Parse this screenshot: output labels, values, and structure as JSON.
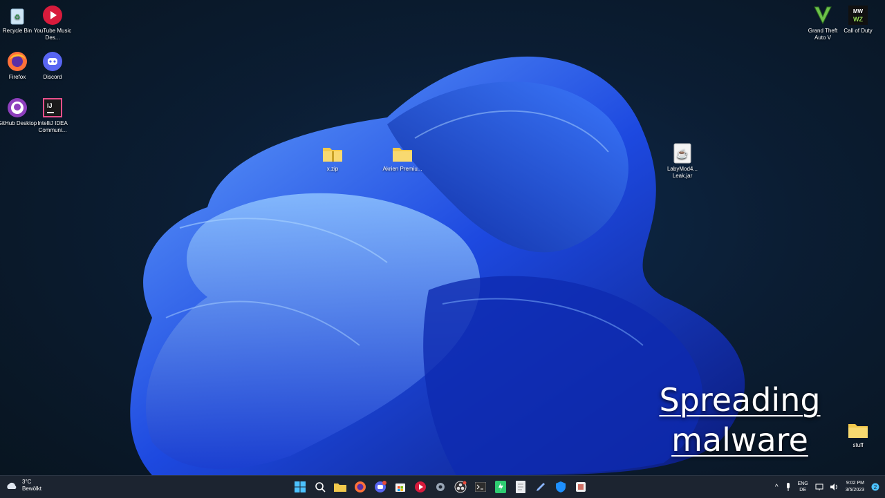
{
  "desktop": {
    "icons_left": [
      {
        "label": "Recycle Bin",
        "icon": "recycle-bin-icon"
      },
      {
        "label": "YouTube Music Des...",
        "icon": "youtube-music-icon"
      },
      {
        "label": "Firefox",
        "icon": "firefox-icon"
      },
      {
        "label": "Discord",
        "icon": "discord-icon"
      },
      {
        "label": "GitHub Desktop",
        "icon": "github-icon"
      },
      {
        "label": "IntelliJ IDEA Communi...",
        "icon": "intellij-icon"
      }
    ],
    "icons_center": [
      {
        "label": "x.zip",
        "icon": "folder-zip-icon"
      },
      {
        "label": "Akrien Premiu...",
        "icon": "folder-icon"
      },
      {
        "label": "LabyMod4... Leak.jar",
        "icon": "java-jar-icon"
      }
    ],
    "icons_right": [
      {
        "label": "Grand Theft Auto V",
        "icon": "gta-v-icon"
      },
      {
        "label": "Call of Duty",
        "icon": "call-of-duty-icon"
      },
      {
        "label": "stuff",
        "icon": "folder-icon"
      }
    ]
  },
  "overlay": {
    "line1": "Spreading",
    "line2": "malware"
  },
  "taskbar": {
    "weather": {
      "temp": "3°C",
      "condition": "Bewölkt"
    },
    "apps": [
      "windows-start-icon",
      "search-icon",
      "file-explorer-icon",
      "firefox-icon",
      "discord-icon",
      "microsoft-store-icon",
      "youtube-music-icon",
      "settings-icon",
      "obs-icon",
      "terminal-icon",
      "notepad-green-icon",
      "document-icon",
      "pen-tool-icon",
      "shield-icon",
      "app-icon"
    ],
    "tray": {
      "lang1": "ENG",
      "lang2": "DE",
      "time": "9:02 PM",
      "date": "3/5/2023"
    }
  },
  "colors": {
    "accent": "#2b6bff",
    "taskbar": "#1c2430"
  }
}
